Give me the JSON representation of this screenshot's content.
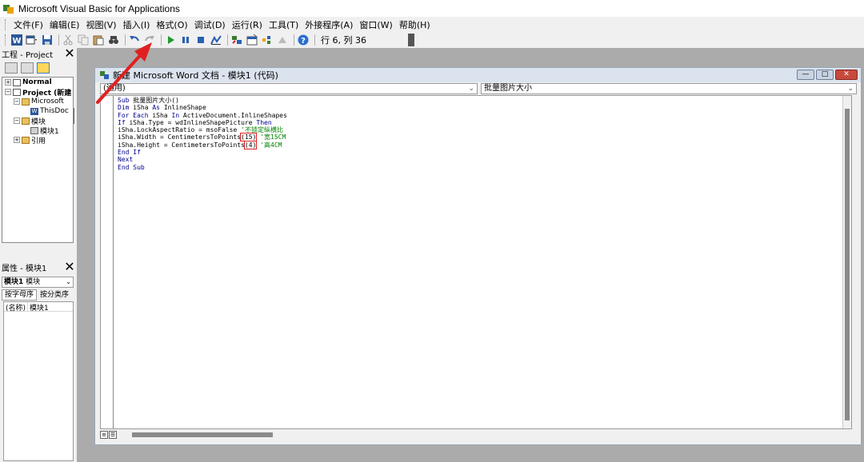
{
  "window": {
    "title": "Microsoft Visual Basic for Applications"
  },
  "menu": [
    "文件(F)",
    "编辑(E)",
    "视图(V)",
    "插入(I)",
    "格式(O)",
    "调试(D)",
    "运行(R)",
    "工具(T)",
    "外接程序(A)",
    "窗口(W)",
    "帮助(H)"
  ],
  "toolbar": {
    "icons": [
      "word-icon",
      "insert-module-icon",
      "save-icon",
      "cut-icon",
      "copy-icon",
      "paste-icon",
      "find-icon",
      "undo-icon",
      "redo-icon",
      "run-icon",
      "break-icon",
      "reset-icon",
      "design-mode-icon",
      "project-explorer-icon",
      "properties-icon",
      "object-browser-icon",
      "toolbox-icon",
      "help-icon"
    ],
    "cursor_position": "行 6, 列 36"
  },
  "project_panel": {
    "title": "工程 - Project",
    "close": "✕",
    "tree": [
      {
        "label": "Normal",
        "level": 0,
        "expander": "+",
        "icon": "vba-project-icon"
      },
      {
        "label": "Project (新建",
        "level": 0,
        "expander": "−",
        "icon": "vba-project-icon"
      },
      {
        "label": "Microsoft",
        "level": 1,
        "expander": "−",
        "icon": "folder-icon"
      },
      {
        "label": "ThisDoc",
        "level": 2,
        "expander": "",
        "icon": "word-document-icon"
      },
      {
        "label": "模块",
        "level": 1,
        "expander": "−",
        "icon": "folder-icon"
      },
      {
        "label": "模块1",
        "level": 2,
        "expander": "",
        "icon": "module-icon"
      },
      {
        "label": "引用",
        "level": 1,
        "expander": "+",
        "icon": "folder-icon"
      }
    ]
  },
  "properties_panel": {
    "title": "属性 - 模块1",
    "close": "✕",
    "object_name": "模块1",
    "object_type": "模块",
    "tabs": [
      "按字母序",
      "按分类序"
    ],
    "rows": [
      {
        "name": "(名称)",
        "value": "模块1"
      }
    ]
  },
  "code_window": {
    "title": "新建 Microsoft Word 文档 - 模块1 (代码)",
    "object_combo": "(通用)",
    "procedure_combo": "批量图片大小",
    "buttons": [
      "—",
      "□",
      "✕"
    ],
    "lines": [
      {
        "parts": [
          {
            "t": "Sub",
            "k": "kw"
          },
          {
            "t": " 批量图片大小()"
          }
        ]
      },
      {
        "parts": [
          {
            "t": "Dim",
            "k": "kw"
          },
          {
            "t": " iSha "
          },
          {
            "t": "As",
            "k": "kw"
          },
          {
            "t": " InlineShape"
          }
        ]
      },
      {
        "parts": [
          {
            "t": "For Each",
            "k": "kw"
          },
          {
            "t": " iSha "
          },
          {
            "t": "In",
            "k": "kw"
          },
          {
            "t": " ActiveDocument.InlineShapes"
          }
        ]
      },
      {
        "parts": [
          {
            "t": "If",
            "k": "kw"
          },
          {
            "t": " iSha.Type = wdInlineShapePicture "
          },
          {
            "t": "Then",
            "k": "kw"
          }
        ]
      },
      {
        "parts": [
          {
            "t": "iSha.LockAspectRatio = msoFalse "
          },
          {
            "t": "'不锁定纵横比",
            "k": "cm"
          }
        ]
      },
      {
        "parts": [
          {
            "t": "iSha.Width = CentimetersToPoints"
          },
          {
            "t": "(15)",
            "k": "box"
          },
          {
            "t": " "
          },
          {
            "t": "'宽15CM",
            "k": "cm"
          }
        ]
      },
      {
        "parts": [
          {
            "t": "iSha.Height = CentimetersToPoints"
          },
          {
            "t": "(4)",
            "k": "box"
          },
          {
            "t": " "
          },
          {
            "t": "'高4CM",
            "k": "cm"
          }
        ]
      },
      {
        "parts": [
          {
            "t": "End If",
            "k": "kw"
          }
        ]
      },
      {
        "parts": [
          {
            "t": "Next",
            "k": "kw"
          }
        ]
      },
      {
        "parts": [
          {
            "t": "End Sub",
            "k": "kw"
          }
        ]
      }
    ]
  },
  "colors": {
    "keyword": "#00008b",
    "comment": "#008000",
    "annotation": "#e02020"
  }
}
